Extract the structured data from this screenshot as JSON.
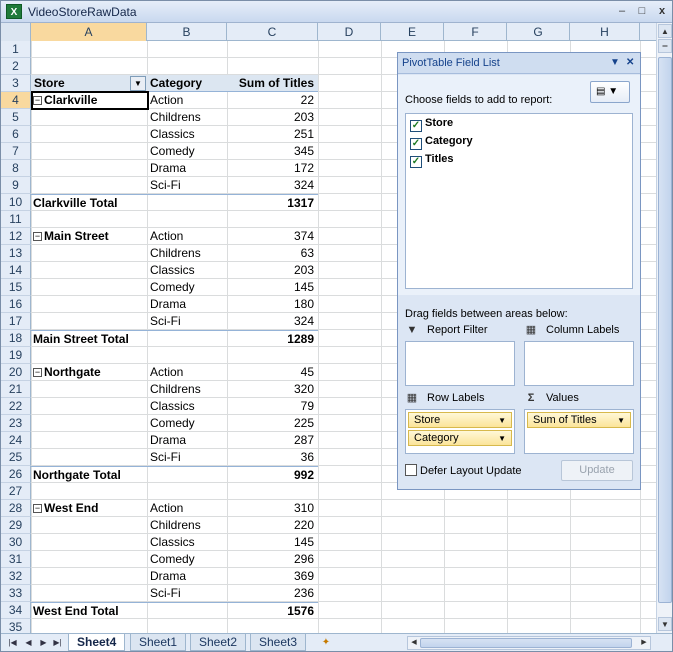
{
  "window": {
    "title": "VideoStoreRawData",
    "app_icon": "excel-icon",
    "minimize": "–",
    "maximize": "□",
    "close": "x"
  },
  "columns": [
    "A",
    "B",
    "C",
    "D",
    "E",
    "F",
    "G",
    "H"
  ],
  "active_cell": "A4",
  "row_numbers": [
    "1",
    "2",
    "3",
    "4",
    "5",
    "6",
    "7",
    "8",
    "9",
    "10",
    "11",
    "12",
    "13",
    "14",
    "15",
    "16",
    "17",
    "18",
    "19",
    "20",
    "21",
    "22",
    "23",
    "24",
    "25",
    "26",
    "27",
    "28",
    "29",
    "30",
    "31",
    "32",
    "33",
    "34",
    "35"
  ],
  "pivot": {
    "headers": {
      "store": "Store",
      "category": "Category",
      "sum": "Sum of Titles"
    },
    "groups": [
      {
        "store": "Clarkville",
        "total_label": "Clarkville Total",
        "total": "1317",
        "rows": [
          [
            "Action",
            "22"
          ],
          [
            "Childrens",
            "203"
          ],
          [
            "Classics",
            "251"
          ],
          [
            "Comedy",
            "345"
          ],
          [
            "Drama",
            "172"
          ],
          [
            "Sci-Fi",
            "324"
          ]
        ]
      },
      {
        "store": "Main Street",
        "total_label": "Main Street Total",
        "total": "1289",
        "rows": [
          [
            "Action",
            "374"
          ],
          [
            "Childrens",
            "63"
          ],
          [
            "Classics",
            "203"
          ],
          [
            "Comedy",
            "145"
          ],
          [
            "Drama",
            "180"
          ],
          [
            "Sci-Fi",
            "324"
          ]
        ]
      },
      {
        "store": "Northgate",
        "total_label": "Northgate Total",
        "total": "992",
        "rows": [
          [
            "Action",
            "45"
          ],
          [
            "Childrens",
            "320"
          ],
          [
            "Classics",
            "79"
          ],
          [
            "Comedy",
            "225"
          ],
          [
            "Drama",
            "287"
          ],
          [
            "Sci-Fi",
            "36"
          ]
        ]
      },
      {
        "store": "West End",
        "total_label": "West End Total",
        "total": "1576",
        "rows": [
          [
            "Action",
            "310"
          ],
          [
            "Childrens",
            "220"
          ],
          [
            "Classics",
            "145"
          ],
          [
            "Comedy",
            "296"
          ],
          [
            "Drama",
            "369"
          ],
          [
            "Sci-Fi",
            "236"
          ]
        ]
      }
    ]
  },
  "field_list": {
    "title": "PivotTable Field List",
    "choose_label": "Choose fields to add to report:",
    "fields": [
      {
        "name": "Store",
        "checked": true
      },
      {
        "name": "Category",
        "checked": true
      },
      {
        "name": "Titles",
        "checked": true
      }
    ],
    "drag_label": "Drag fields between areas below:",
    "areas": {
      "report_filter": "Report Filter",
      "column_labels": "Column Labels",
      "row_labels": "Row Labels",
      "values": "Values"
    },
    "row_fields": [
      "Store",
      "Category"
    ],
    "value_fields": [
      "Sum of Titles"
    ],
    "defer_label": "Defer Layout Update",
    "update_label": "Update"
  },
  "sheets": {
    "tabs": [
      "Sheet4",
      "Sheet1",
      "Sheet2",
      "Sheet3"
    ],
    "active": "Sheet4"
  },
  "colors": {
    "header_bg": "#dce6f1",
    "active_header": "#f9d99f",
    "panel_bg": "#dce6f4",
    "field_chip": "#fbe49a"
  }
}
